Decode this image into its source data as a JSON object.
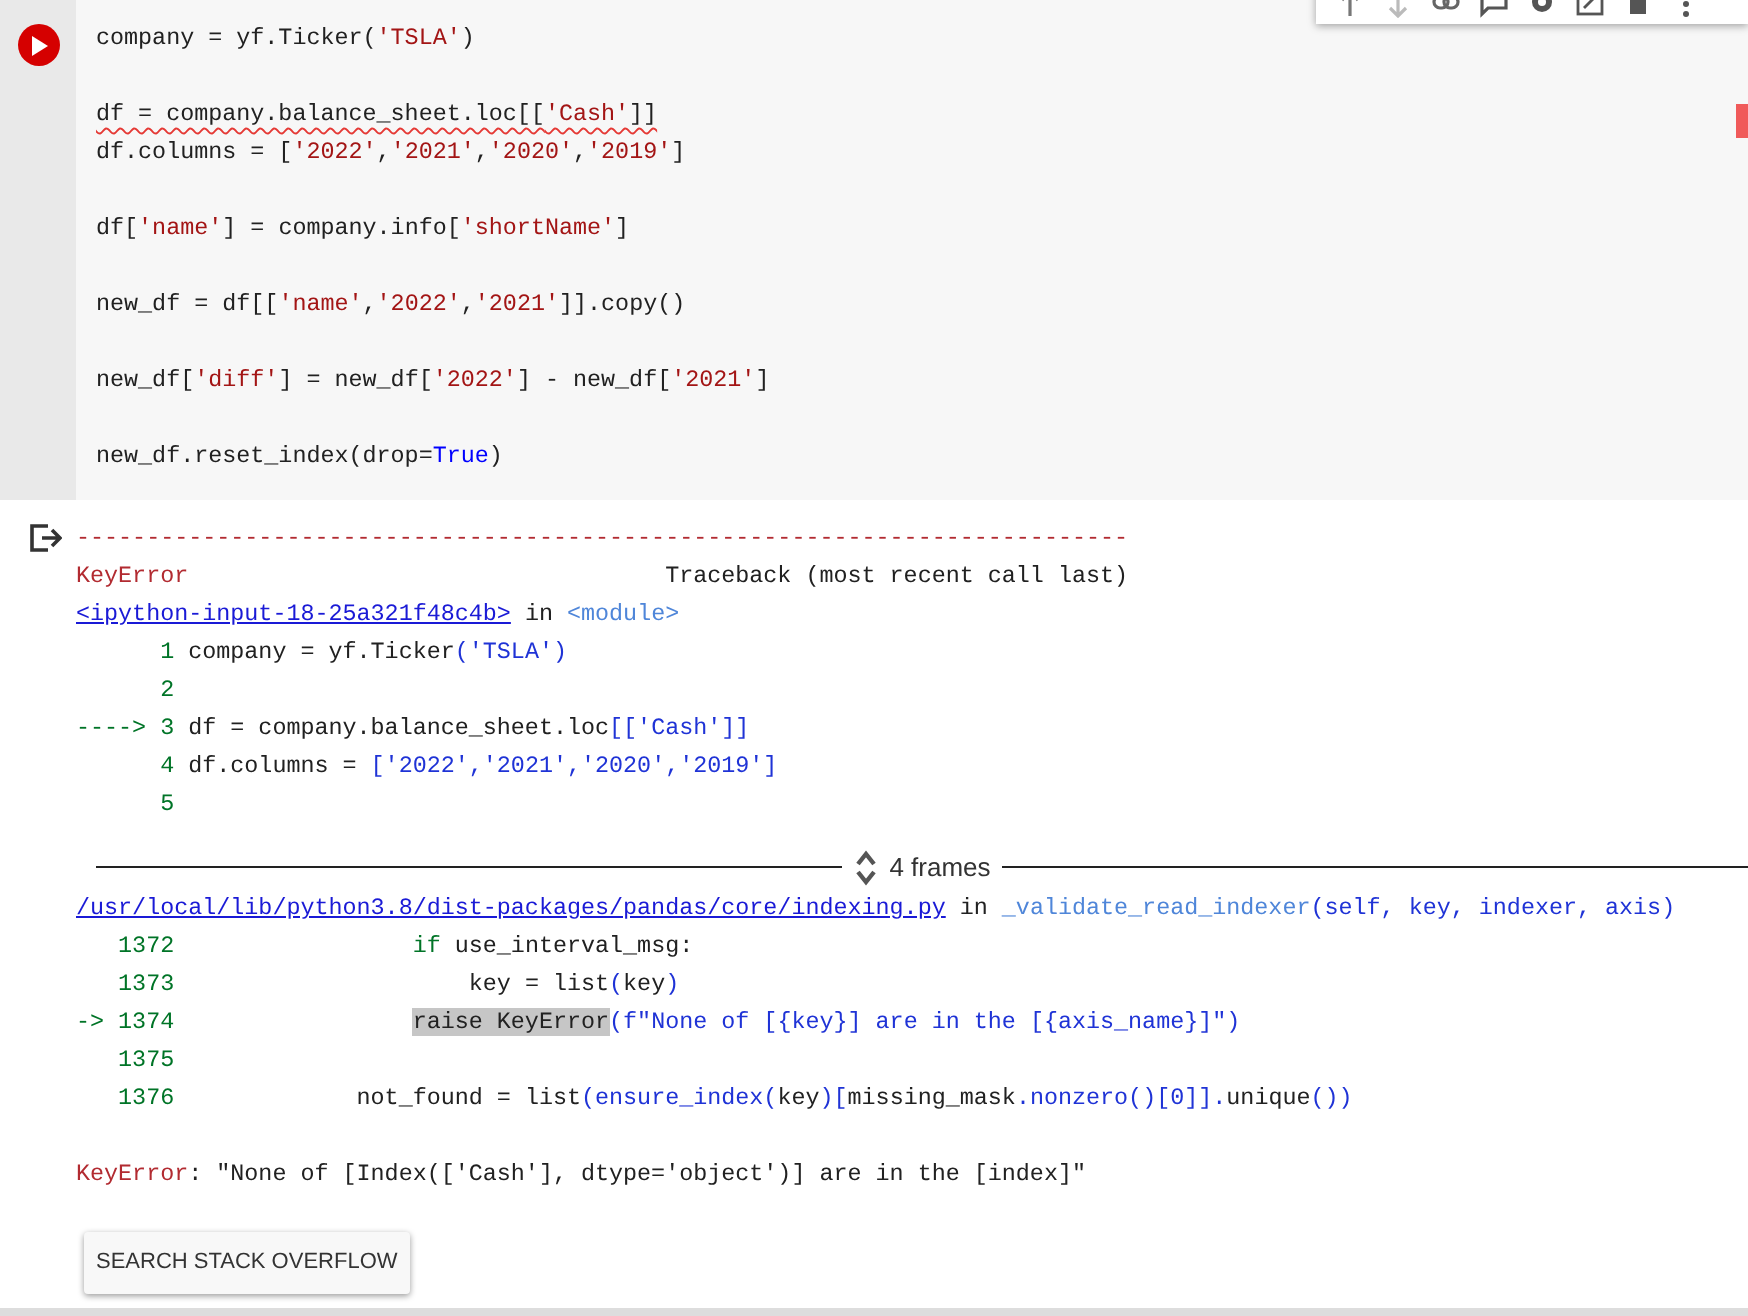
{
  "input_cell": {
    "blocks": [
      [
        {
          "flagged": false,
          "segments": [
            {
              "text": "company = yf.Ticker(",
              "kind": "plain"
            },
            {
              "text": "'TSLA'",
              "kind": "str"
            },
            {
              "text": ")",
              "kind": "plain"
            }
          ]
        }
      ],
      [
        {
          "flagged": true,
          "segments": [
            {
              "text": "df = company.balance_sheet.loc[[",
              "kind": "plain"
            },
            {
              "text": "'Cash'",
              "kind": "str"
            },
            {
              "text": "]]",
              "kind": "plain"
            }
          ]
        },
        {
          "flagged": false,
          "segments": [
            {
              "text": "df.columns = [",
              "kind": "plain"
            },
            {
              "text": "'2022'",
              "kind": "str"
            },
            {
              "text": ",",
              "kind": "plain"
            },
            {
              "text": "'2021'",
              "kind": "str"
            },
            {
              "text": ",",
              "kind": "plain"
            },
            {
              "text": "'2020'",
              "kind": "str"
            },
            {
              "text": ",",
              "kind": "plain"
            },
            {
              "text": "'2019'",
              "kind": "str"
            },
            {
              "text": "]",
              "kind": "plain"
            }
          ]
        }
      ],
      [
        {
          "flagged": false,
          "segments": [
            {
              "text": "df[",
              "kind": "plain"
            },
            {
              "text": "'name'",
              "kind": "str"
            },
            {
              "text": "] = company.info[",
              "kind": "plain"
            },
            {
              "text": "'shortName'",
              "kind": "str"
            },
            {
              "text": "]",
              "kind": "plain"
            }
          ]
        }
      ],
      [
        {
          "flagged": false,
          "segments": [
            {
              "text": "new_df = df[[",
              "kind": "plain"
            },
            {
              "text": "'name'",
              "kind": "str"
            },
            {
              "text": ",",
              "kind": "plain"
            },
            {
              "text": "'2022'",
              "kind": "str"
            },
            {
              "text": ",",
              "kind": "plain"
            },
            {
              "text": "'2021'",
              "kind": "str"
            },
            {
              "text": "]].copy()",
              "kind": "plain"
            }
          ]
        }
      ],
      [
        {
          "flagged": false,
          "segments": [
            {
              "text": "new_df[",
              "kind": "plain"
            },
            {
              "text": "'diff'",
              "kind": "str"
            },
            {
              "text": "] = new_df[",
              "kind": "plain"
            },
            {
              "text": "'2022'",
              "kind": "str"
            },
            {
              "text": "] - new_df[",
              "kind": "plain"
            },
            {
              "text": "'2021'",
              "kind": "str"
            },
            {
              "text": "]",
              "kind": "plain"
            }
          ]
        }
      ],
      [
        {
          "flagged": false,
          "segments": [
            {
              "text": "new_df.reset_index(drop=",
              "kind": "plain"
            },
            {
              "text": "True",
              "kind": "kw"
            },
            {
              "text": ")",
              "kind": "plain"
            }
          ]
        }
      ]
    ]
  },
  "traceback": {
    "head": [
      [
        {
          "text": "---------------------------------------------------------------------------",
          "kind": "err"
        }
      ],
      [
        {
          "text": "KeyError",
          "kind": "err"
        },
        {
          "text": "                                  Traceback (most recent call last)",
          "kind": "plain"
        }
      ],
      [
        {
          "text": "<ipython-input-18-25a321f48c4b>",
          "kind": "link"
        },
        {
          "text": " in ",
          "kind": "plain"
        },
        {
          "text": "<module>",
          "kind": "func"
        }
      ],
      [
        {
          "text": "      1 ",
          "kind": "num"
        },
        {
          "text": "company = yf.Ticker",
          "kind": "plain"
        },
        {
          "text": "('TSLA')",
          "kind": "blue"
        }
      ],
      [
        {
          "text": "      2",
          "kind": "num"
        }
      ],
      [
        {
          "text": "----> 3 ",
          "kind": "num"
        },
        {
          "text": "df = company.balance_sheet.loc",
          "kind": "plain"
        },
        {
          "text": "[['Cash']]",
          "kind": "blue"
        }
      ],
      [
        {
          "text": "      4 ",
          "kind": "num"
        },
        {
          "text": "df.columns = ",
          "kind": "plain"
        },
        {
          "text": "['2022','2021','2020','2019']",
          "kind": "blue"
        }
      ],
      [
        {
          "text": "      5",
          "kind": "num"
        }
      ]
    ],
    "frames": {
      "label": "4 frames",
      "expanded": false
    },
    "tail": [
      [
        {
          "text": "/usr/local/lib/python3.8/dist-packages/pandas/core/indexing.py",
          "kind": "link"
        },
        {
          "text": " in ",
          "kind": "plain"
        },
        {
          "text": "_validate_read_indexer",
          "kind": "func"
        },
        {
          "text": "(self, key, indexer, axis)",
          "kind": "blue"
        }
      ],
      [
        {
          "text": "   1372                 ",
          "kind": "num"
        },
        {
          "text": "if",
          "kind": "num"
        },
        {
          "text": " use_interval_msg:",
          "kind": "plain"
        }
      ],
      [
        {
          "text": "   1373                     ",
          "kind": "num"
        },
        {
          "text": "key = list",
          "kind": "plain"
        },
        {
          "text": "(",
          "kind": "blue"
        },
        {
          "text": "key",
          "kind": "plain"
        },
        {
          "text": ")",
          "kind": "blue"
        }
      ],
      [
        {
          "text": "-> 1374                 ",
          "kind": "num"
        },
        {
          "text": "raise KeyError",
          "kind": "hl"
        },
        {
          "text": "(f\"None of [{key}] are in the [{axis_name}]\")",
          "kind": "blue"
        }
      ],
      [
        {
          "text": "   1375",
          "kind": "num"
        }
      ],
      [
        {
          "text": "   1376             ",
          "kind": "num"
        },
        {
          "text": "not_found = list",
          "kind": "plain"
        },
        {
          "text": "(ensure_index(",
          "kind": "blue"
        },
        {
          "text": "key",
          "kind": "plain"
        },
        {
          "text": ")[",
          "kind": "blue"
        },
        {
          "text": "missing_mask",
          "kind": "plain"
        },
        {
          "text": ".nonzero()[0]].",
          "kind": "blue"
        },
        {
          "text": "unique",
          "kind": "plain"
        },
        {
          "text": "())",
          "kind": "blue"
        }
      ]
    ],
    "message": [
      {
        "text": "KeyError",
        "kind": "err"
      },
      {
        "text": ": \"None of [Index(['Cash'], dtype='object')] are in the [index]\"",
        "kind": "plain"
      }
    ]
  },
  "search_button": "SEARCH STACK OVERFLOW"
}
